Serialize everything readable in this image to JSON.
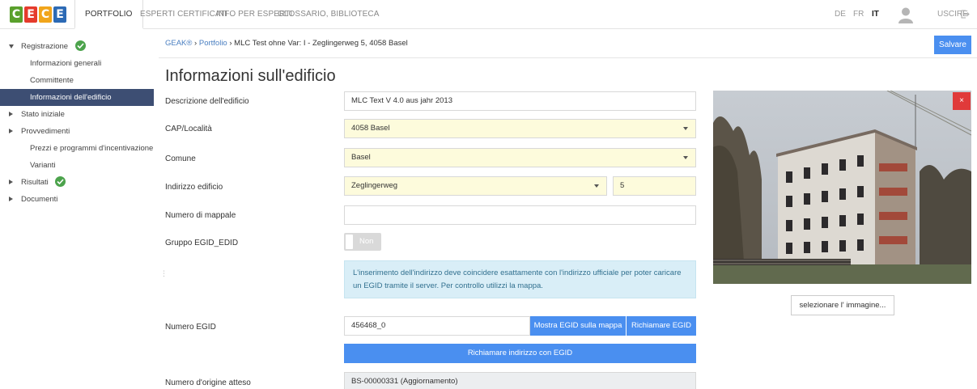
{
  "logo": {
    "letters": [
      "C",
      "E",
      "C",
      "E"
    ],
    "colors": [
      "#5aa02c",
      "#e53b2c",
      "#f1a51b",
      "#2c6ab5"
    ]
  },
  "topnav": {
    "items": [
      "PORTFOLIO",
      "ESPERTI CERTIFICATI",
      "INFO PER ESPERTI",
      "GLOSSARIO, BIBLIOTECA"
    ],
    "active": "PORTFOLIO"
  },
  "languages": [
    "DE",
    "FR",
    "IT"
  ],
  "active_language": "IT",
  "logout_label": "USCIRE",
  "sidebar": {
    "registrazione": "Registrazione",
    "informazioni_generali": "Informazioni generali",
    "committente": "Committente",
    "informazioni_edificio": "Informazioni dell'edificio",
    "stato_iniziale": "Stato iniziale",
    "provvedimenti": "Provvedimenti",
    "prezzi": "Prezzi e programmi d'incentivazione",
    "varianti": "Varianti",
    "risultati": "Risultati",
    "documenti": "Documenti"
  },
  "breadcrumb": {
    "root": "GEAK®",
    "sep1": "›",
    "portfolio": "Portfolio",
    "sep2": "›",
    "current": "MLC Test ohne Var: I - Zeglingerweg 5, 4058 Basel"
  },
  "save_label": "Salvare",
  "page_title": "Informazioni sull'edificio",
  "form": {
    "descrizione_label": "Descrizione dell'edificio",
    "descrizione_value": "MLC Text V 4.0 aus jahr 2013",
    "cap_label": "CAP/Località",
    "cap_value": "4058 Basel",
    "comune_label": "Comune",
    "comune_value": "Basel",
    "indirizzo_label": "Indirizzo edificio",
    "indirizzo_street": "Zeglingerweg",
    "indirizzo_number": "5",
    "mappale_label": "Numero di mappale",
    "mappale_value": "",
    "gruppo_label": "Gruppo EGID_EDID",
    "gruppo_toggle": "Non",
    "info_text": "L'inserimento dell'indirizzo deve coincidere esattamente con l'indirizzo ufficiale per poter caricare un EGID tramite il server. Per controllo utilizzi la mappa.",
    "egid_label": "Numero EGID",
    "egid_value": "456468_0",
    "mostra_egid": "Mostra EGID sulla mappa",
    "richiamare_egid": "Richiamare EGID",
    "richiamare_indirizzo": "Richiamare indirizzo con EGID",
    "origine_label": "Numero d'origine atteso",
    "origine_value": "BS-00000331 (Aggiornamento)"
  },
  "image_panel": {
    "close": "×",
    "select_label": "selezionare l' immagine..."
  }
}
